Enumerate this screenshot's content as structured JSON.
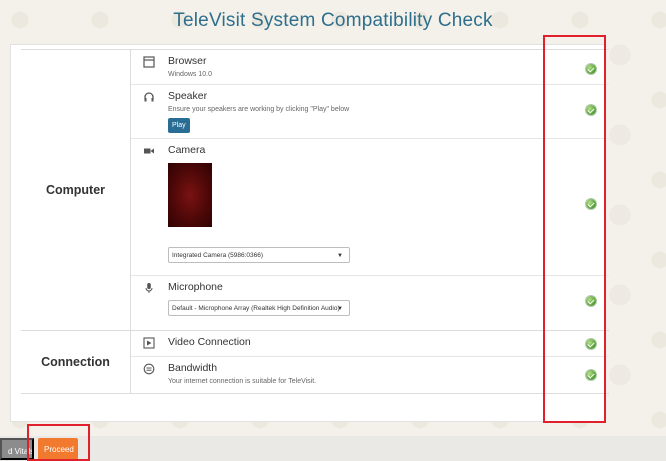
{
  "page": {
    "title": "TeleVisit System Compatibility Check"
  },
  "sections": [
    {
      "label": "Computer",
      "rows": [
        {
          "title": "Browser",
          "subtitle": "Windows 10.0",
          "icon": "browser-window-icon",
          "status": "ok"
        },
        {
          "title": "Speaker",
          "subtitle": "Ensure your speakers are working by clicking \"Play\" below",
          "button": "Play",
          "icon": "headphones-icon",
          "status": "ok"
        },
        {
          "title": "Camera",
          "icon": "video-camera-icon",
          "select_value": "Integrated Camera (5986:0366)",
          "status": "ok"
        },
        {
          "title": "Microphone",
          "icon": "microphone-icon",
          "select_value": "Default - Microphone Array (Realtek High Definition Audio)",
          "status": "ok"
        }
      ]
    },
    {
      "label": "Connection",
      "rows": [
        {
          "title": "Video Connection",
          "icon": "video-connection-icon",
          "status": "ok"
        },
        {
          "title": "Bandwidth",
          "subtitle": "Your internet connection is suitable for TeleVisit.",
          "icon": "speedometer-icon",
          "status": "ok"
        }
      ]
    }
  ],
  "footer": {
    "prev_label": "d Vitals",
    "proceed_label": "Proceed"
  },
  "colors": {
    "title": "#2d6f8c",
    "play_button": "#2a6d94",
    "proceed_button": "#f27a2f",
    "status_ok": "#5aa33c",
    "highlight": "#e0212b"
  }
}
